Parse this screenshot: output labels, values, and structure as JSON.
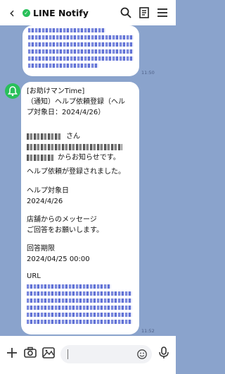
{
  "header": {
    "title": "LINE Notify",
    "back_icon": "back-arrow-icon",
    "verified_icon": "verified-badge-icon"
  },
  "messages": [
    {
      "time": "11:50"
    },
    {
      "time": "11:52",
      "lines": [
        "[お助けマンTime]",
        "（通知）ヘルプ依頼登録（ヘル",
        "プ対象日：2024/4/26）",
        "さん",
        "からお知らせです。",
        "ヘルプ依頼が登録されました。",
        "ヘルプ対象日",
        "2024/4/26",
        "店舗からのメッセージ",
        "ご回答をお願いします。",
        "回答期限",
        "2024/04/25 00:00",
        "URL"
      ]
    }
  ]
}
